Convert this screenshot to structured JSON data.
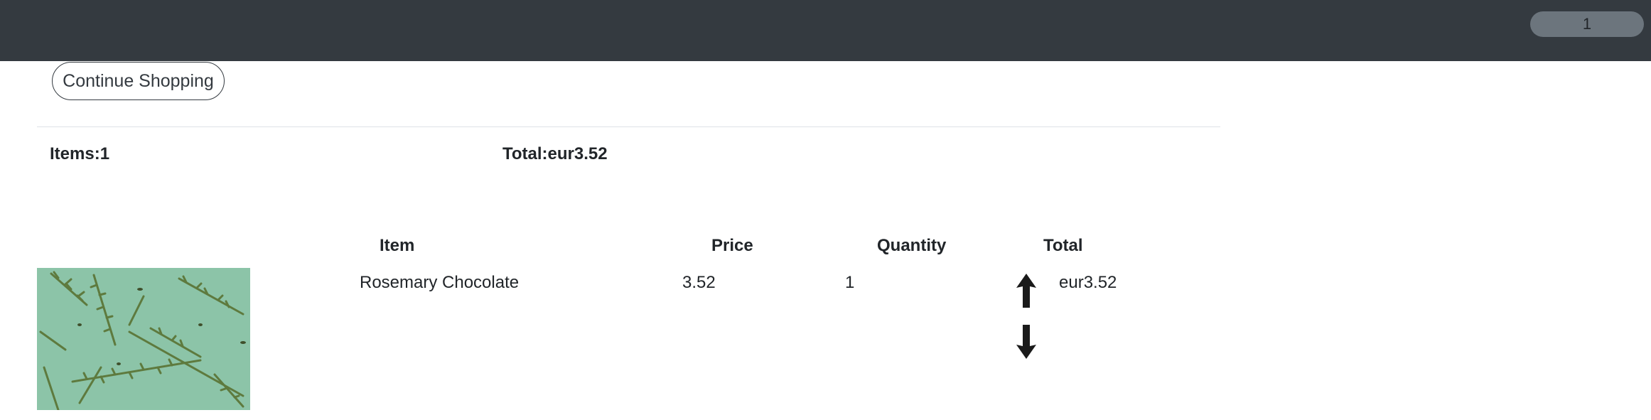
{
  "navbar": {
    "cart_count": "1"
  },
  "buttons": {
    "continue_shopping": "Continue Shopping"
  },
  "summary": {
    "items_label": "Items:",
    "items_value": "1",
    "total_label": "Total:",
    "total_value": "eur3.52"
  },
  "table": {
    "headers": {
      "item": "Item",
      "price": "Price",
      "quantity": "Quantity",
      "total": "Total"
    },
    "rows": [
      {
        "name": "Rosemary Chocolate",
        "price": "3.52",
        "quantity": "1",
        "total": "eur3.52",
        "image_icon": "rosemary-sprigs-image"
      }
    ]
  },
  "icons": {
    "increase": "arrow-up-icon",
    "decrease": "arrow-down-icon"
  },
  "colors": {
    "navbar_bg": "#343a40",
    "cart_pill_bg": "#6c757d",
    "image_bg": "#8cc4a8",
    "sprig": "#5e7a3e"
  }
}
